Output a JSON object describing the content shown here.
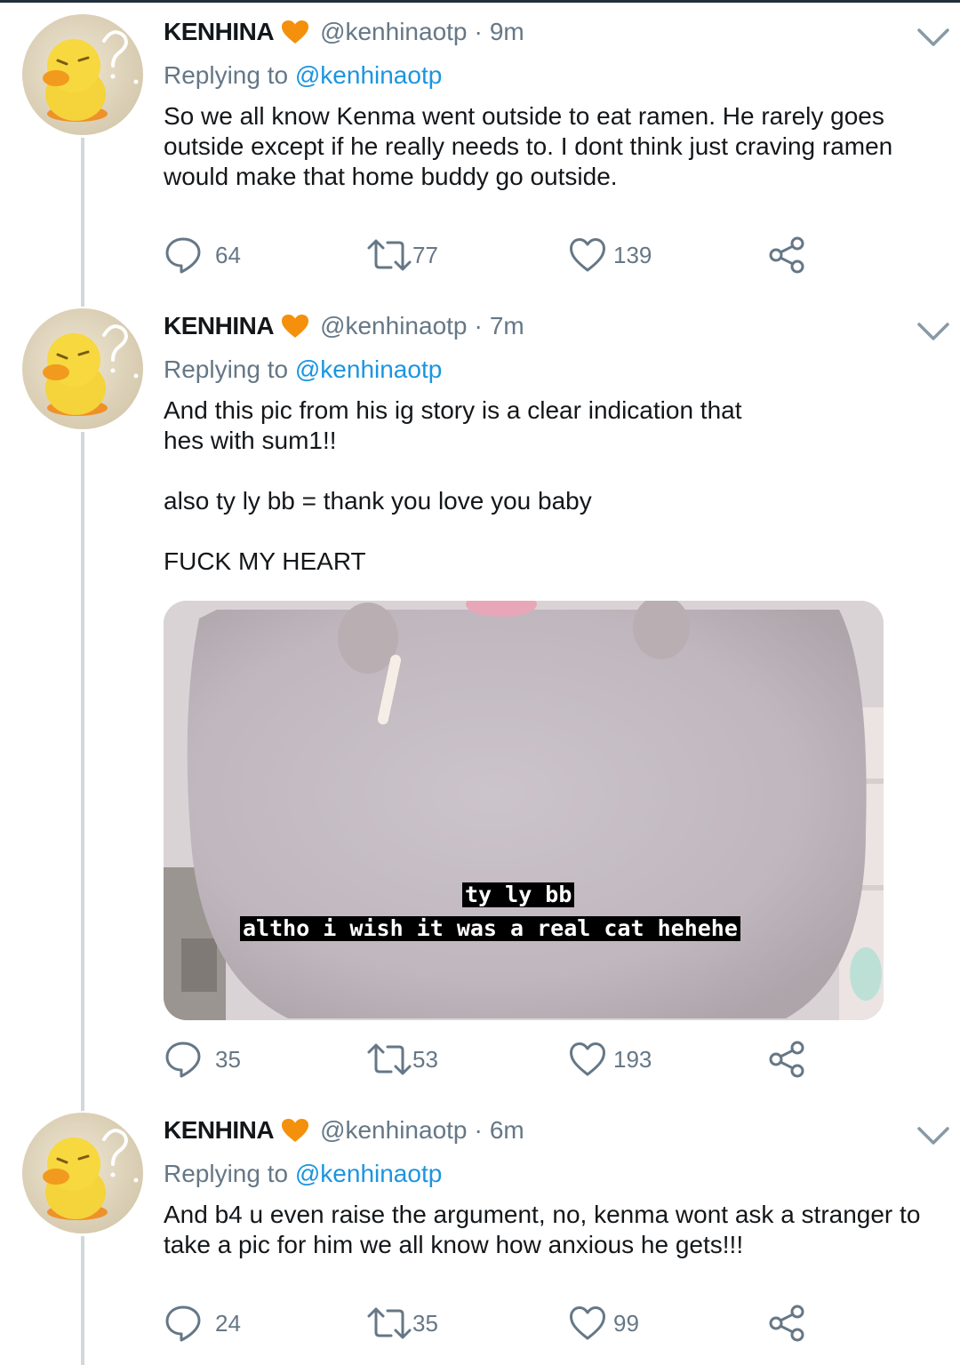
{
  "tweets": [
    {
      "display_name": "KENHINA",
      "handle": "@kenhinaotp",
      "separator": "·",
      "time": "9m",
      "replying_prefix": "Replying to",
      "replying_handle": "@kenhinaotp",
      "text": "So we all know Kenma went outside to eat ramen. He rarely goes outside except if he really needs to. I dont think just craving ramen would make that home buddy go outside.",
      "stats": {
        "replies": "64",
        "retweets": "77",
        "likes": "139"
      }
    },
    {
      "display_name": "KENHINA",
      "handle": "@kenhinaotp",
      "separator": "·",
      "time": "7m",
      "replying_prefix": "Replying to",
      "replying_handle": "@kenhinaotp",
      "text": "And this pic from his ig story is a clear indication that\nhes with sum1!!\n\nalso ty ly bb = thank you love you baby\n\nFUCK MY HEART",
      "media": {
        "caption_line1": "ty ly bb",
        "caption_line2": "altho i wish it was a real cat hehehe"
      },
      "stats": {
        "replies": "35",
        "retweets": "53",
        "likes": "193"
      }
    },
    {
      "display_name": "KENHINA",
      "handle": "@kenhinaotp",
      "separator": "·",
      "time": "6m",
      "replying_prefix": "Replying to",
      "replying_handle": "@kenhinaotp",
      "text": "And b4 u even raise the argument, no, kenma wont ask a stranger to take a pic for him we all know how anxious he gets!!!",
      "stats": {
        "replies": "24",
        "retweets": "35",
        "likes": "99"
      }
    }
  ],
  "icons": {
    "verified_like_badge": "orange-heart-icon",
    "menu": "chevron-down-icon",
    "reply": "reply-bubble-icon",
    "retweet": "retweet-icon",
    "like": "heart-outline-icon",
    "share": "share-icon"
  },
  "colors": {
    "text": "#14171a",
    "secondary": "#657786",
    "link": "#1b95e0",
    "thread_line": "#cfd9de",
    "heart_badge": "#f4900c"
  }
}
